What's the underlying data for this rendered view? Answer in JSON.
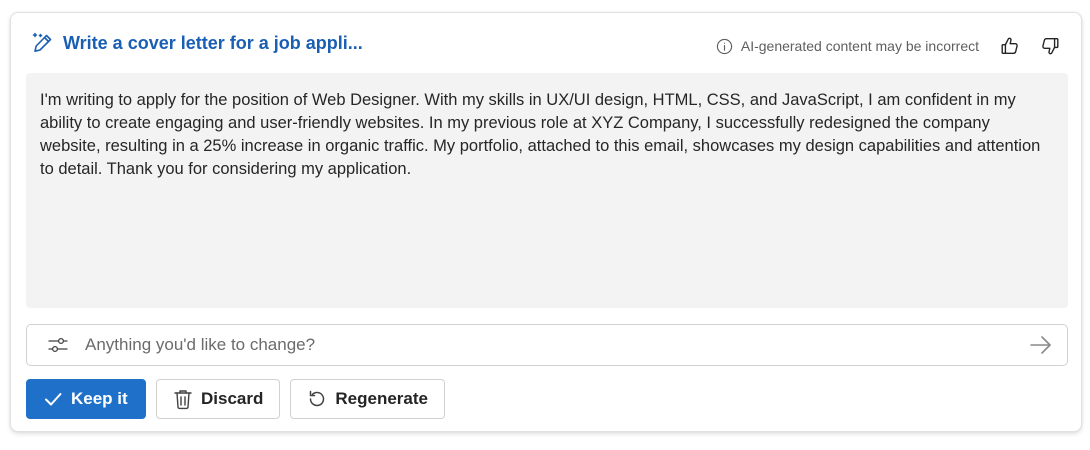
{
  "header": {
    "title": "Write a cover letter for a job appli...",
    "title_icon": "magic-pen-icon",
    "disclaimer": "AI-generated content may be incorrect",
    "info_icon": "info-icon",
    "like_icon": "thumbs-up-icon",
    "dislike_icon": "thumbs-down-icon"
  },
  "content": {
    "text": "I'm writing to apply for the position of Web Designer. With my skills in UX/UI design, HTML, CSS, and JavaScript, I am confident in my ability to create engaging and user-friendly websites. In my previous role at XYZ Company, I successfully redesigned the company website, resulting in a 25% increase in organic traffic. My portfolio, attached to this email, showcases my design capabilities and attention to detail. Thank you for considering my application."
  },
  "refine": {
    "placeholder": "Anything you'd like to change?",
    "value": "",
    "options_icon": "sliders-icon",
    "send_icon": "arrow-right-icon"
  },
  "actions": {
    "keep_label": "Keep it",
    "discard_label": "Discard",
    "regenerate_label": "Regenerate"
  },
  "colors": {
    "accent": "#1f70c8",
    "title": "#1a5fb4",
    "content_bg": "#f3f3f3"
  }
}
